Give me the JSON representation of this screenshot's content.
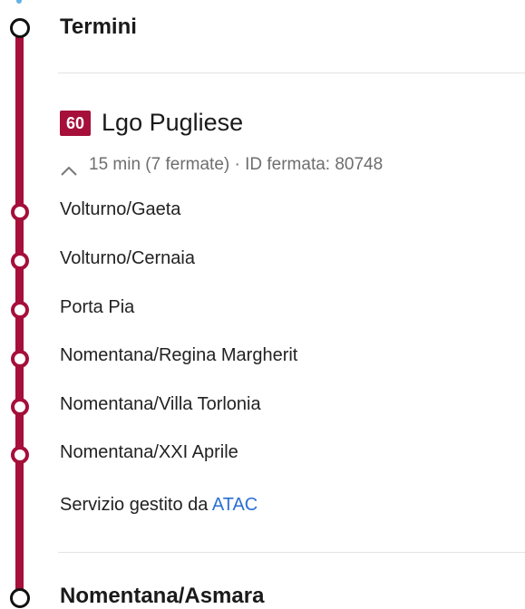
{
  "origin": {
    "name": "Termini"
  },
  "line": {
    "number": "60",
    "destination": "Lgo Pugliese",
    "trip_info": "15 min (7 fermate) · ID fermata: 80748",
    "color": "#a50f3a"
  },
  "stops": [
    {
      "name": "Volturno/Gaeta"
    },
    {
      "name": "Volturno/Cernaia"
    },
    {
      "name": "Porta Pia"
    },
    {
      "name": "Nomentana/Regina Margherit"
    },
    {
      "name": "Nomentana/Villa Torlonia"
    },
    {
      "name": "Nomentana/XXI Aprile"
    }
  ],
  "operator": {
    "prefix": "Servizio gestito da ",
    "name": "ATAC",
    "link_color": "#2a6fd6"
  },
  "destination": {
    "name": "Nomentana/Asmara"
  },
  "icons": {
    "collapse": "chevron-up-icon",
    "terminal_stop": "hollow-circle-icon",
    "intermediate_stop": "red-ring-icon"
  }
}
